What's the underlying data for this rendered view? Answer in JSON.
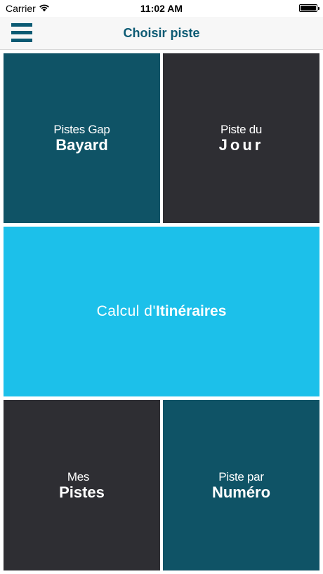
{
  "status_bar": {
    "carrier": "Carrier",
    "time": "11:02 AM",
    "wifi_icon": "wifi-icon",
    "battery_icon": "battery-full-icon"
  },
  "nav": {
    "menu_icon": "hamburger-menu-icon",
    "title": "Choisir piste"
  },
  "tiles": {
    "gap_bayard": {
      "line1": "Pistes Gap",
      "line2": "Bayard"
    },
    "piste_du_jour": {
      "line1": "Piste du",
      "line2": "Jour"
    },
    "itineraires": {
      "light": "Calcul d'",
      "bold": "Itinéraires"
    },
    "mes_pistes": {
      "line1": "Mes",
      "line2": "Pistes"
    },
    "piste_par_numero": {
      "line1": "Piste par",
      "line2": "Numéro"
    }
  },
  "colors": {
    "teal": "#0f5366",
    "dark": "#2e2e33",
    "cyan": "#1cc0ea",
    "nav_accent": "#0b5a73"
  }
}
